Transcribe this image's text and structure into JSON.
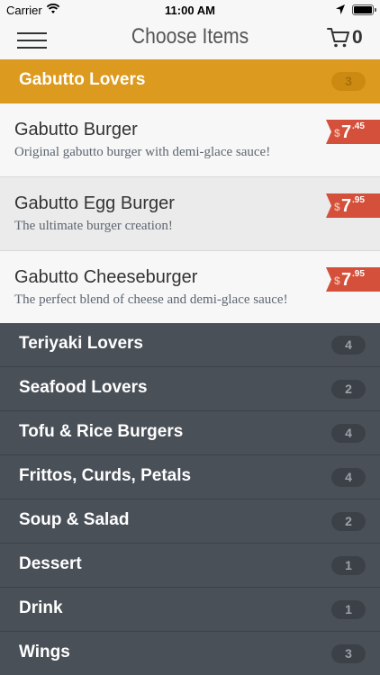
{
  "status_bar": {
    "carrier": "Carrier",
    "time": "11:00 AM"
  },
  "nav": {
    "title": "Choose Items",
    "cart_count": "0"
  },
  "active_category": {
    "name": "Gabutto Lovers",
    "count": "3"
  },
  "items": [
    {
      "name": "Gabutto Burger",
      "description": "Original gabutto burger with demi-glace sauce!",
      "currency": "$",
      "price_whole": "7",
      "price_fraction": ".45"
    },
    {
      "name": "Gabutto Egg Burger",
      "description": "The ultimate burger creation!",
      "currency": "$",
      "price_whole": "7",
      "price_fraction": ".95"
    },
    {
      "name": "Gabutto Cheeseburger",
      "description": "The perfect blend of cheese and demi-glace sauce!",
      "currency": "$",
      "price_whole": "7",
      "price_fraction": ".95"
    }
  ],
  "categories": [
    {
      "name": "Teriyaki Lovers",
      "count": "4"
    },
    {
      "name": "Seafood Lovers",
      "count": "2"
    },
    {
      "name": "Tofu & Rice Burgers",
      "count": "4"
    },
    {
      "name": "Frittos, Curds, Petals",
      "count": "4"
    },
    {
      "name": "Soup & Salad",
      "count": "2"
    },
    {
      "name": "Dessert",
      "count": "1"
    },
    {
      "name": "Drink",
      "count": "1"
    },
    {
      "name": "Wings",
      "count": "3"
    }
  ],
  "colors": {
    "accent": "#dc9a1e",
    "price_tag": "#d4503a",
    "category_bg": "#4a5058",
    "item_bg_light": "#f7f7f7",
    "item_bg_alt": "#ebebeb"
  },
  "icons": {
    "menu": "hamburger-menu-icon",
    "cart": "shopping-cart-icon",
    "wifi": "wifi-icon",
    "location": "location-arrow-icon",
    "battery": "battery-icon"
  }
}
